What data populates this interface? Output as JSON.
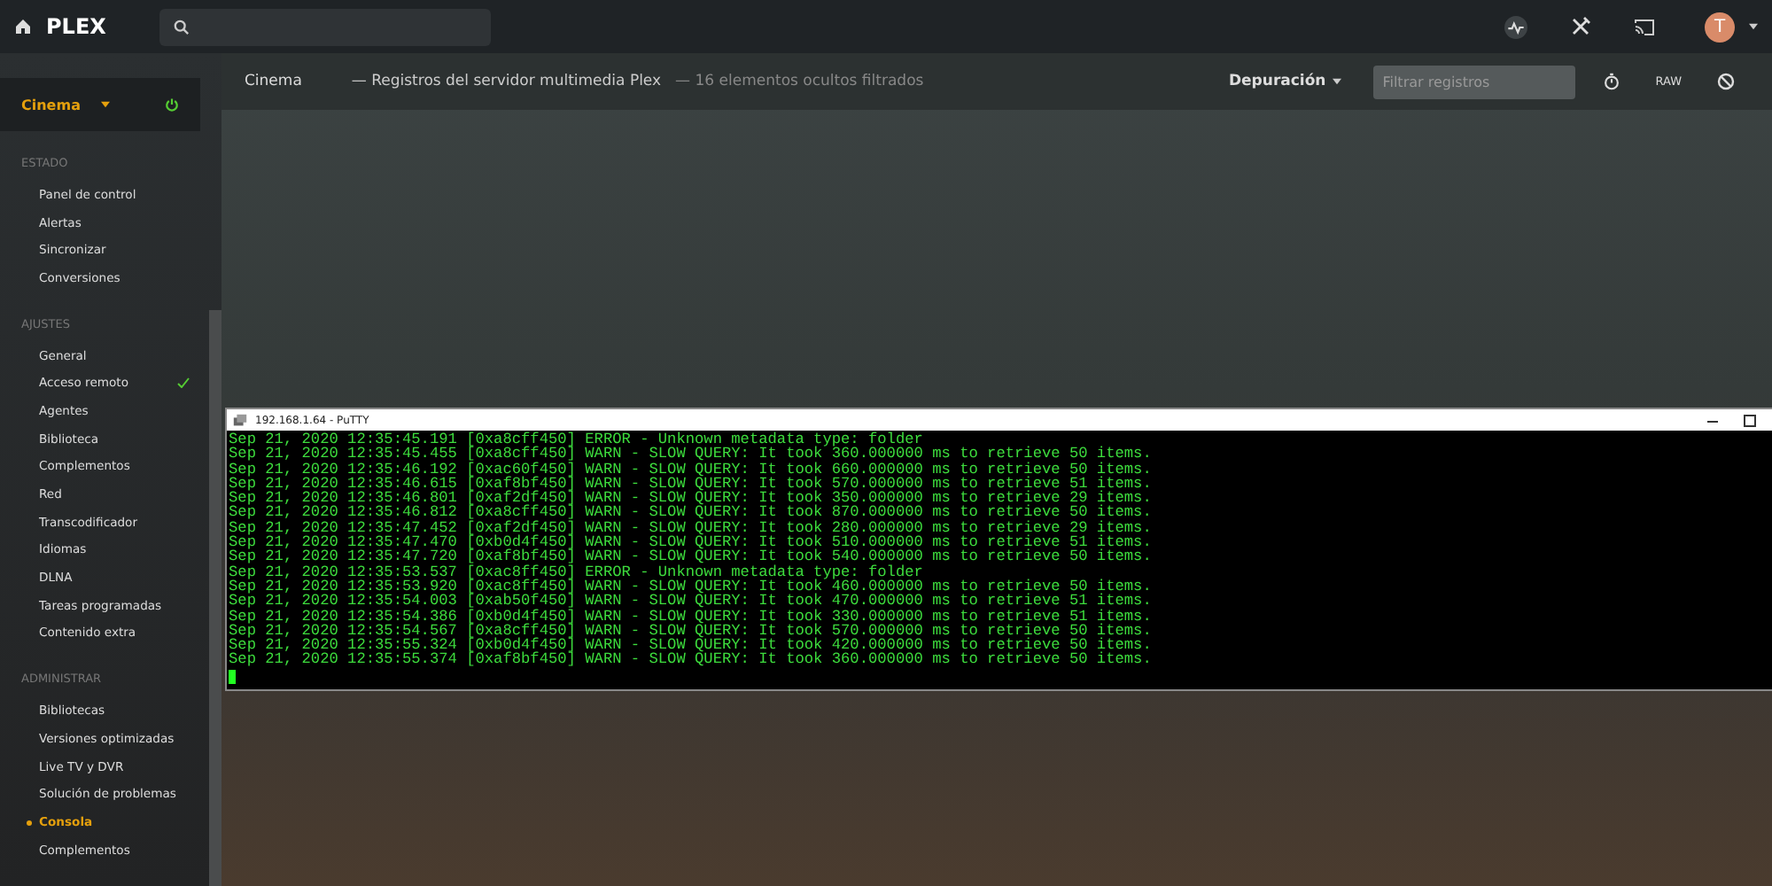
{
  "topbar": {
    "logo": "PLEX",
    "avatar": "T"
  },
  "sidebar": {
    "server": {
      "name": "Cinema"
    },
    "sections": [
      {
        "title": "ESTADO",
        "items": [
          {
            "label": "Panel de control",
            "selected": false,
            "checked": false
          },
          {
            "label": "Alertas",
            "selected": false,
            "checked": false
          },
          {
            "label": "Sincronizar",
            "selected": false,
            "checked": false
          },
          {
            "label": "Conversiones",
            "selected": false,
            "checked": false
          }
        ]
      },
      {
        "title": "AJUSTES",
        "items": [
          {
            "label": "General",
            "selected": false,
            "checked": false
          },
          {
            "label": "Acceso remoto",
            "selected": false,
            "checked": true
          },
          {
            "label": "Agentes",
            "selected": false,
            "checked": false
          },
          {
            "label": "Biblioteca",
            "selected": false,
            "checked": false
          },
          {
            "label": "Complementos",
            "selected": false,
            "checked": false
          },
          {
            "label": "Red",
            "selected": false,
            "checked": false
          },
          {
            "label": "Transcodificador",
            "selected": false,
            "checked": false
          },
          {
            "label": "Idiomas",
            "selected": false,
            "checked": false
          },
          {
            "label": "DLNA",
            "selected": false,
            "checked": false
          },
          {
            "label": "Tareas programadas",
            "selected": false,
            "checked": false
          },
          {
            "label": "Contenido extra",
            "selected": false,
            "checked": false
          }
        ]
      },
      {
        "title": "ADMINISTRAR",
        "items": [
          {
            "label": "Bibliotecas",
            "selected": false,
            "checked": false
          },
          {
            "label": "Versiones optimizadas",
            "selected": false,
            "checked": false
          },
          {
            "label": "Live TV y DVR",
            "selected": false,
            "checked": false
          },
          {
            "label": "Solución de problemas",
            "selected": false,
            "checked": false
          },
          {
            "label": "Consola",
            "selected": true,
            "checked": false
          },
          {
            "label": "Complementos",
            "selected": false,
            "checked": false
          }
        ]
      }
    ]
  },
  "header": {
    "server": "Cinema",
    "title": "— Registros del servidor multimedia Plex",
    "note": "— 16 elementos ocultos filtrados",
    "level": "Depuración",
    "filter": {
      "placeholder": "Filtrar registros"
    },
    "raw": "RAW"
  },
  "terminal": {
    "title": "192.168.1.64 - PuTTY",
    "lines": [
      "Sep 21, 2020 12:35:45.191 [0xa8cff450] ERROR - Unknown metadata type: folder",
      "Sep 21, 2020 12:35:45.455 [0xa8cff450] WARN - SLOW QUERY: It took 360.000000 ms to retrieve 50 items.",
      "Sep 21, 2020 12:35:46.192 [0xac60f450] WARN - SLOW QUERY: It took 660.000000 ms to retrieve 50 items.",
      "Sep 21, 2020 12:35:46.615 [0xaf8bf450] WARN - SLOW QUERY: It took 570.000000 ms to retrieve 51 items.",
      "Sep 21, 2020 12:35:46.801 [0xaf2df450] WARN - SLOW QUERY: It took 350.000000 ms to retrieve 29 items.",
      "Sep 21, 2020 12:35:46.812 [0xa8cff450] WARN - SLOW QUERY: It took 870.000000 ms to retrieve 50 items.",
      "Sep 21, 2020 12:35:47.452 [0xaf2df450] WARN - SLOW QUERY: It took 280.000000 ms to retrieve 29 items.",
      "Sep 21, 2020 12:35:47.470 [0xb0d4f450] WARN - SLOW QUERY: It took 510.000000 ms to retrieve 51 items.",
      "Sep 21, 2020 12:35:47.720 [0xaf8bf450] WARN - SLOW QUERY: It took 540.000000 ms to retrieve 50 items.",
      "Sep 21, 2020 12:35:53.537 [0xac8ff450] ERROR - Unknown metadata type: folder",
      "Sep 21, 2020 12:35:53.920 [0xac8ff450] WARN - SLOW QUERY: It took 460.000000 ms to retrieve 50 items.",
      "Sep 21, 2020 12:35:54.003 [0xab50f450] WARN - SLOW QUERY: It took 470.000000 ms to retrieve 51 items.",
      "Sep 21, 2020 12:35:54.386 [0xb0d4f450] WARN - SLOW QUERY: It took 330.000000 ms to retrieve 51 items.",
      "Sep 21, 2020 12:35:54.567 [0xa8cff450] WARN - SLOW QUERY: It took 570.000000 ms to retrieve 50 items.",
      "Sep 21, 2020 12:35:55.324 [0xb0d4f450] WARN - SLOW QUERY: It took 420.000000 ms to retrieve 50 items.",
      "Sep 21, 2020 12:35:55.374 [0xaf8bf450] WARN - SLOW QUERY: It took 360.000000 ms to retrieve 50 items."
    ]
  }
}
